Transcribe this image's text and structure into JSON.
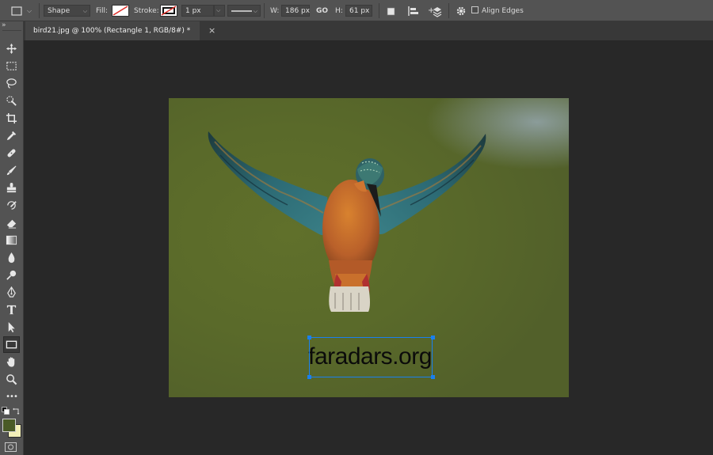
{
  "options_bar": {
    "tool_mode": "Shape",
    "fill_label": "Fill:",
    "stroke_label": "Stroke:",
    "stroke_width": "1 px",
    "width_label": "W:",
    "width_value": "186 px",
    "link_label": "GO",
    "height_label": "H:",
    "height_value": "61 px",
    "align_edges_label": "Align Edges",
    "align_edges_checked": false
  },
  "document_tab": {
    "title": "bird21.jpg @ 100% (Rectangle 1, RGB/8#) *",
    "close_glyph": "×"
  },
  "toolbar": {
    "collapse_glyph": "»",
    "more_glyph": "•••",
    "selected_tool": "rectangle-tool",
    "foreground_color": "#4a5a26",
    "background_color": "#f3efb8"
  },
  "canvas": {
    "watermark_text": "faradars.org"
  }
}
